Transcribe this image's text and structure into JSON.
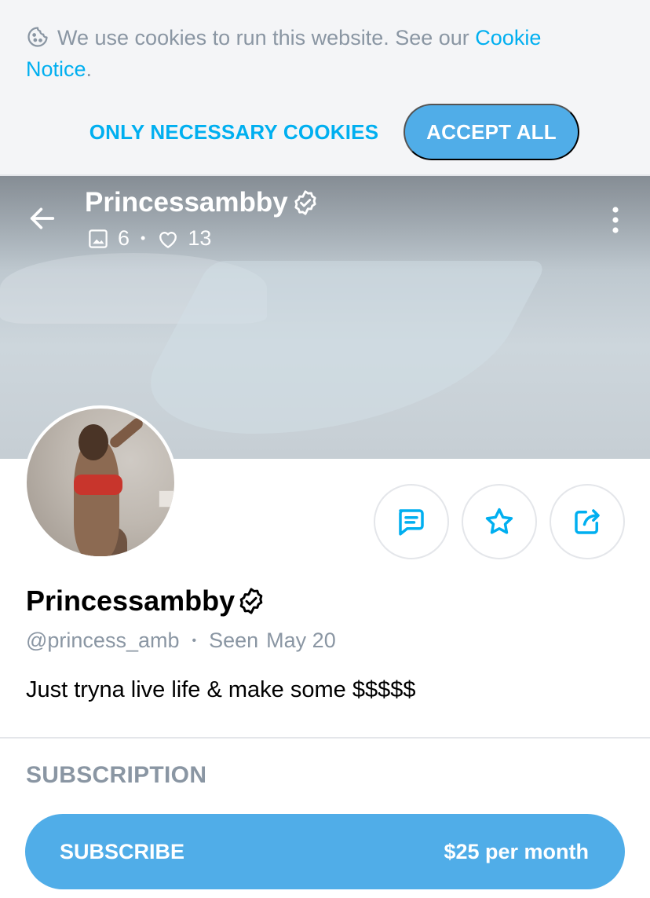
{
  "cookie_banner": {
    "text": "We use cookies to run this website. See our",
    "link_text": "Cookie Notice",
    "after_link": ".",
    "necessary_label": "ONLY NECESSARY COOKIES",
    "accept_label": "ACCEPT ALL"
  },
  "header": {
    "name": "Princessambby",
    "media_count": "6",
    "likes_count": "13"
  },
  "profile": {
    "name": "Princessambby",
    "username": "@princess_amb",
    "seen_label": "Seen",
    "seen_date": "May 20",
    "bio": "Just tryna live life & make some $$$$$"
  },
  "subscription": {
    "title": "SUBSCRIPTION",
    "button_label": "SUBSCRIBE",
    "price": "$25 per month"
  },
  "colors": {
    "accent": "#00aff0",
    "button": "#50ade8",
    "muted": "#8a96a3"
  }
}
